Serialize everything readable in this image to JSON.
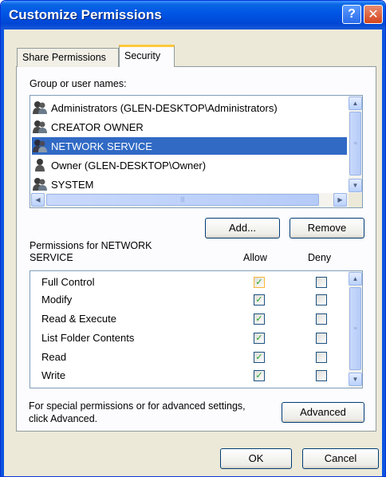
{
  "window": {
    "title": "Customize Permissions",
    "help_glyph": "?",
    "close_glyph": "✕"
  },
  "tabs": [
    {
      "label": "Share Permissions",
      "active": false
    },
    {
      "label": "Security",
      "active": true
    }
  ],
  "group_list": {
    "label": "Group or user names:",
    "items": [
      {
        "name": "Administrators (GLEN-DESKTOP\\Administrators)",
        "icon": "group-users-icon",
        "selected": false
      },
      {
        "name": "CREATOR OWNER",
        "icon": "group-users-icon",
        "selected": false
      },
      {
        "name": "NETWORK SERVICE",
        "icon": "group-users-icon",
        "selected": true
      },
      {
        "name": "Owner (GLEN-DESKTOP\\Owner)",
        "icon": "user-icon",
        "selected": false
      },
      {
        "name": "SYSTEM",
        "icon": "group-users-icon",
        "selected": false
      }
    ]
  },
  "buttons": {
    "add": "Add...",
    "remove": "Remove",
    "advanced": "Advanced",
    "ok": "OK",
    "cancel": "Cancel"
  },
  "permissions": {
    "header_line1": "Permissions for NETWORK",
    "header_line2": "SERVICE",
    "allow_label": "Allow",
    "deny_label": "Deny",
    "rows": [
      {
        "name": "Full Control",
        "allow": true,
        "deny": false
      },
      {
        "name": "Modify",
        "allow": true,
        "deny": false
      },
      {
        "name": "Read & Execute",
        "allow": true,
        "deny": false
      },
      {
        "name": "List Folder Contents",
        "allow": true,
        "deny": false
      },
      {
        "name": "Read",
        "allow": true,
        "deny": false
      },
      {
        "name": "Write",
        "allow": true,
        "deny": false
      }
    ]
  },
  "advanced_note": {
    "line1": "For special permissions or for advanced settings,",
    "line2": "click Advanced."
  },
  "colors": {
    "titlebar": "#0055e5",
    "selection": "#316ac5",
    "dialog_bg": "#ece9d8",
    "checkmark": "#21a121"
  }
}
